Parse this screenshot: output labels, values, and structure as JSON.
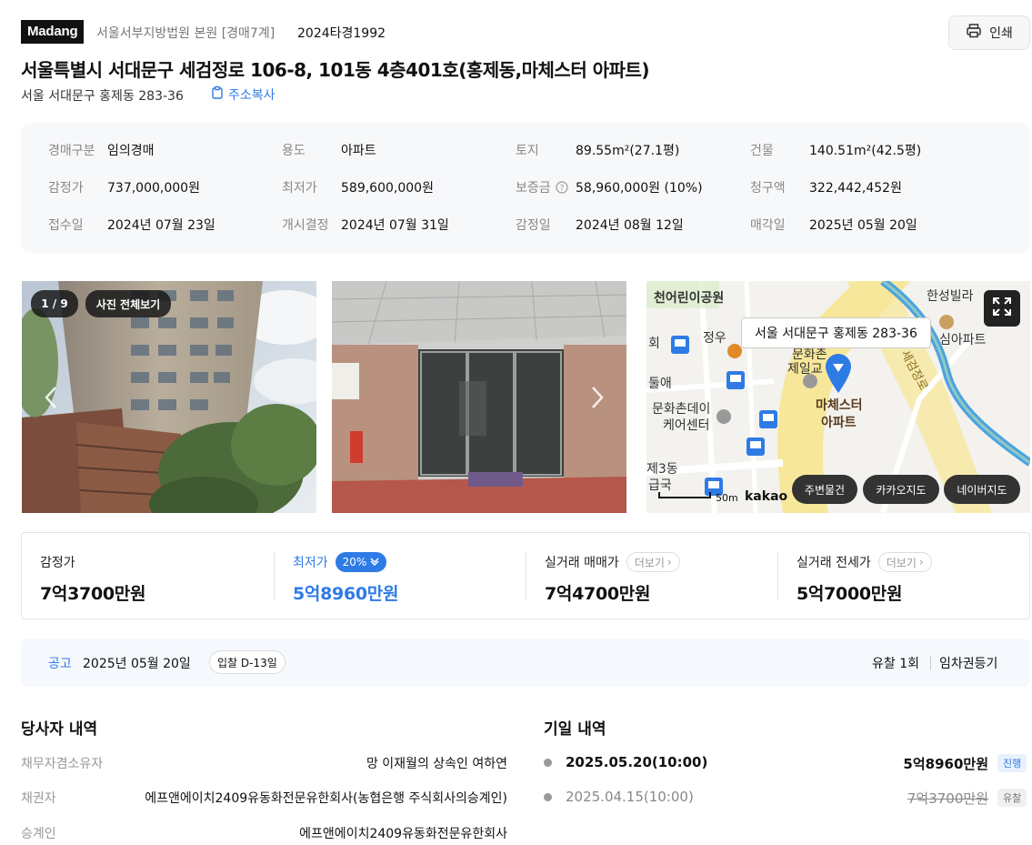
{
  "header": {
    "logo": "Madang",
    "court": "서울서부지방법원 본원 [경매7계]",
    "case_no": "2024타경1992",
    "print_label": "인쇄"
  },
  "property": {
    "title": "서울특별시 서대문구 세검정로 106-8, 101동 4층401호(홍제동,마체스터 아파트)",
    "jibun_address": "서울 서대문구 홍제동 283-36",
    "copy_label": "주소복사"
  },
  "info": [
    {
      "k": "경매구분",
      "v": "임의경매"
    },
    {
      "k": "용도",
      "v": "아파트"
    },
    {
      "k": "토지",
      "v": "89.55m²(27.1평)"
    },
    {
      "k": "건물",
      "v": "140.51m²(42.5평)"
    },
    {
      "k": "감정가",
      "v": "737,000,000원"
    },
    {
      "k": "최저가",
      "v": "589,600,000원"
    },
    {
      "k": "보증금",
      "v": "58,960,000원 (10%)"
    },
    {
      "k": "청구액",
      "v": "322,442,452원"
    },
    {
      "k": "접수일",
      "v": "2024년 07월 23일"
    },
    {
      "k": "개시결정",
      "v": "2024년 07월 31일"
    },
    {
      "k": "감정일",
      "v": "2024년 08월 12일"
    },
    {
      "k": "매각일",
      "v": "2025년 05월 20일"
    }
  ],
  "gallery": {
    "counter": "1 / 9",
    "view_all": "사진 전체보기"
  },
  "map": {
    "tooltip": "서울 서대문구 홍제동 283-36",
    "labels": {
      "park": "천어린이공원",
      "villa": "한성빌라",
      "villa2": "심아파트",
      "jeongu": "정우",
      "hoe": "회",
      "munhwa": "문화촌",
      "jeil": "제일교",
      "apt1": "마체스터",
      "apt2": "아파트",
      "ae": "둘애",
      "center1": "문화촌데이",
      "center2": "케어센터",
      "road": "세검정로",
      "dong3": "제3동",
      "uguk": "급국",
      "scale": "50m",
      "brand": "kakao"
    },
    "buttons": [
      "주변물건",
      "카카오지도",
      "네이버지도"
    ]
  },
  "prices": {
    "appraisal": {
      "label": "감정가",
      "value": "7억3700만원"
    },
    "minimum": {
      "label": "최저가",
      "pct": "20%",
      "value": "5억8960만원"
    },
    "real_sale": {
      "label": "실거래 매매가",
      "more": "더보기",
      "value": "7억4700만원"
    },
    "real_jeonse": {
      "label": "실거래 전세가",
      "more": "더보기",
      "value": "5억7000만원"
    }
  },
  "notice": {
    "label": "공고",
    "date": "2025년 05월 20일",
    "dday": "입찰 D-13일",
    "fail_count": "유찰 1회",
    "lease_reg": "임차권등기"
  },
  "parties": {
    "title": "당사자 내역",
    "rows": [
      {
        "k": "채무자겸소유자",
        "v": "망 이재월의 상속인 여하연"
      },
      {
        "k": "채권자",
        "v": "에프앤에이치2409유동화전문유한회사(농협은행 주식회사의승계인)"
      },
      {
        "k": "승계인",
        "v": "에프앤에이치2409유동화전문유한회사"
      }
    ]
  },
  "schedule": {
    "title": "기일 내역",
    "rows": [
      {
        "date": "2025.05.20(10:00)",
        "price": "5억8960만원",
        "status": "진행"
      },
      {
        "date": "2025.04.15(10:00)",
        "price": "7억3700만원",
        "status": "유찰"
      }
    ]
  },
  "colors": {
    "accent": "#2f7be6",
    "dark": "#111111",
    "muted": "#888888"
  }
}
